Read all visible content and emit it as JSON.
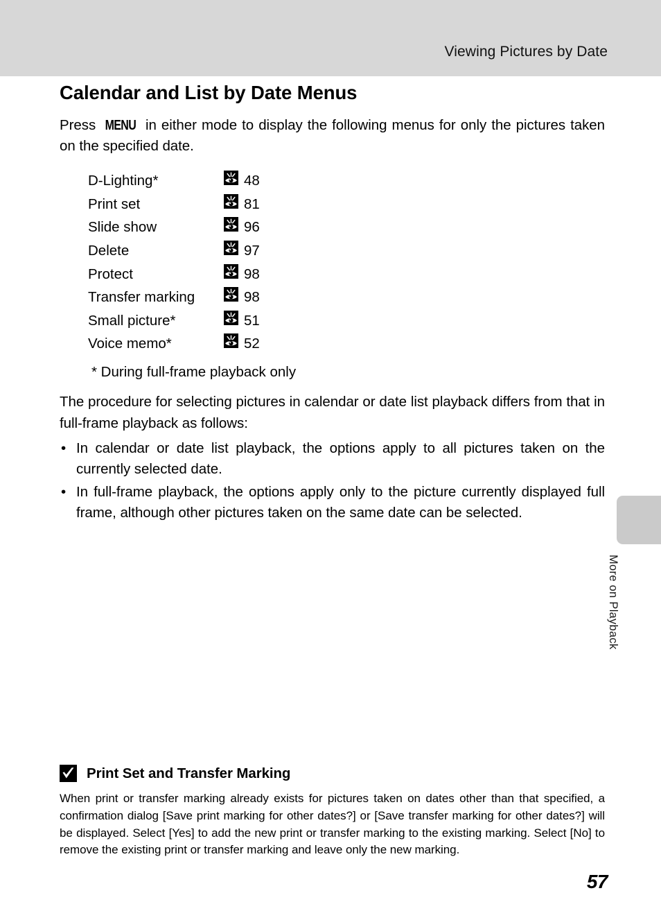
{
  "header": {
    "title": "Viewing Pictures by Date"
  },
  "page": {
    "heading": "Calendar and List by Date Menus",
    "number": "57"
  },
  "intro": {
    "before_menu": "Press ",
    "menu_label": "MENU",
    "after_menu": " in either mode to display the following menus for only the pictures taken on the specified date."
  },
  "menu_items": [
    {
      "label": "D-Lighting*",
      "icon": "eye-reference-icon",
      "page": "48"
    },
    {
      "label": "Print set",
      "icon": "eye-reference-icon",
      "page": "81"
    },
    {
      "label": "Slide show",
      "icon": "eye-reference-icon",
      "page": "96"
    },
    {
      "label": "Delete",
      "icon": "eye-reference-icon",
      "page": "97"
    },
    {
      "label": "Protect",
      "icon": "eye-reference-icon",
      "page": "98"
    },
    {
      "label": "Transfer marking",
      "icon": "eye-reference-icon",
      "page": "98"
    },
    {
      "label": "Small picture*",
      "icon": "eye-reference-icon",
      "page": "51"
    },
    {
      "label": "Voice memo*",
      "icon": "eye-reference-icon",
      "page": "52"
    }
  ],
  "footnote": "* During full-frame playback only",
  "body_paragraph": "The procedure for selecting pictures in calendar or date list playback differs from that in full-frame playback as follows:",
  "bullets": [
    "In calendar or date list playback, the options apply to all pictures taken on the currently selected date.",
    "In full-frame playback, the options apply only to the picture currently displayed full frame, although other pictures taken on the same date can be selected."
  ],
  "side_tab": {
    "label": "More on Playback"
  },
  "note": {
    "icon": "checkmark-box-icon",
    "title": "Print Set and Transfer Marking",
    "body": "When print or transfer marking already exists for pictures taken on dates other than that specified, a confirmation dialog [Save print marking for other dates?] or [Save transfer marking for other dates?] will be displayed. Select [Yes] to add the new print or transfer marking to the existing marking. Select [No] to remove the existing print or transfer marking and leave only the new marking."
  },
  "colors": {
    "header_band": "#d7d7d7",
    "side_tab": "#cacaca",
    "text": "#000000"
  }
}
